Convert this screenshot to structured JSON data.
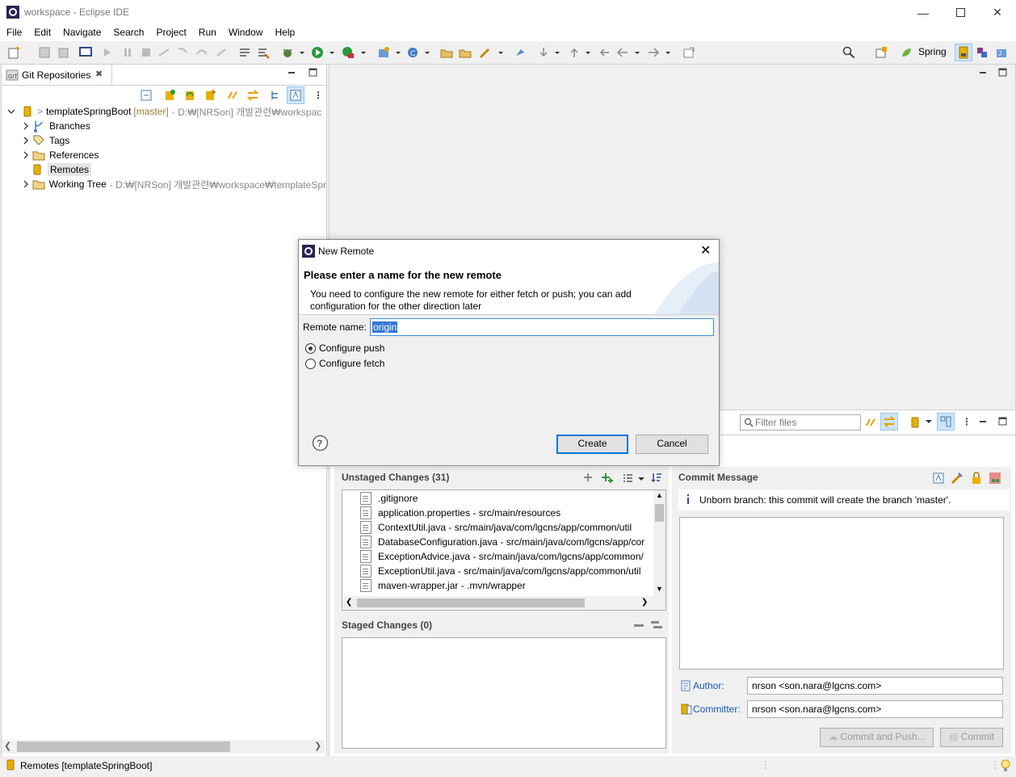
{
  "window": {
    "title": "workspace - Eclipse IDE"
  },
  "menu": [
    "File",
    "Edit",
    "Navigate",
    "Search",
    "Project",
    "Run",
    "Window",
    "Help"
  ],
  "toolbar": {
    "perspective_label": "Spring"
  },
  "git_view": {
    "tab_label": "Git Repositories",
    "repo": {
      "name": "templateSpringBoot",
      "branch": "[master]",
      "path": "- D:₩[NRSon] 개발관련₩workspac",
      "prefix": ">"
    },
    "children": [
      {
        "label": "Branches",
        "icon": "branches-icon"
      },
      {
        "label": "Tags",
        "icon": "tags-icon"
      },
      {
        "label": "References",
        "icon": "folder-icon"
      },
      {
        "label": "Remotes",
        "icon": "remotes-icon"
      },
      {
        "label": "Working Tree",
        "path": "- D:₩[NRSon] 개발관련₩workspace₩templateSpr",
        "icon": "folder-icon"
      }
    ]
  },
  "staging": {
    "filter_placeholder": "Filter files",
    "unstaged_label": "Unstaged Changes (31)",
    "unstaged_files": [
      {
        "name": ".gitignore",
        "path": ""
      },
      {
        "name": "application.properties",
        "path": "- src/main/resources"
      },
      {
        "name": "ContextUtil.java",
        "path": "- src/main/java/com/lgcns/app/common/util"
      },
      {
        "name": "DatabaseConfiguration.java",
        "path": "- src/main/java/com/lgcns/app/cor"
      },
      {
        "name": "ExceptionAdvice.java",
        "path": "- src/main/java/com/lgcns/app/common/"
      },
      {
        "name": "ExceptionUtil.java",
        "path": "- src/main/java/com/lgcns/app/common/util"
      },
      {
        "name": "maven-wrapper.jar",
        "path": "- .mvn/wrapper"
      }
    ],
    "staged_label": "Staged Changes (0)",
    "commit_message_label": "Commit Message",
    "info_text": "Unborn branch: this commit will create the branch 'master'.",
    "author_label": "Author:",
    "author_value": "nrson <son.nara@lgcns.com>",
    "committer_label": "Committer:",
    "committer_value": "nrson <son.nara@lgcns.com>",
    "commit_push_label": "Commit and Push...",
    "commit_label": "Commit"
  },
  "dialog": {
    "title": "New Remote",
    "heading": "Please enter a name for the new remote",
    "description_line1": "You need to configure the new remote for either fetch or push; you can add",
    "description_line2": "configuration for the other direction later",
    "name_label": "Remote name:",
    "name_value": "origin",
    "option_push": "Configure push",
    "option_fetch": "Configure fetch",
    "selected": "push",
    "create_label": "Create",
    "cancel_label": "Cancel"
  },
  "statusbar": {
    "text": "Remotes [templateSpringBoot]"
  }
}
